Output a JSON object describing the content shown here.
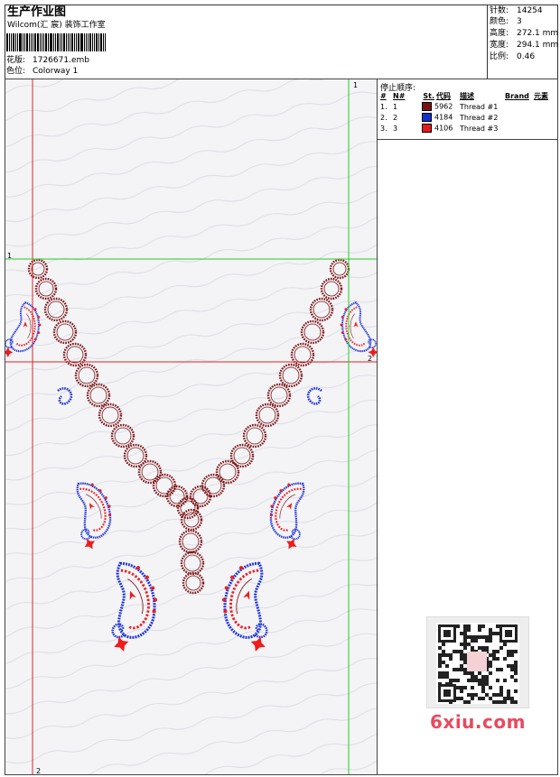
{
  "header": {
    "title": "生产作业图",
    "studio": "Wilcom(汇 宸) 装饰工作室",
    "file_label": "花版:",
    "file_value": "1726671.emb",
    "colorway_label": "色位:",
    "colorway_value": "Colorway 1"
  },
  "specs": {
    "stitches_label": "针数:",
    "stitches_value": "14254",
    "colors_label": "颜色:",
    "colors_value": "3",
    "height_label": "高度:",
    "height_value": "272.1 mm",
    "width_label": "宽度:",
    "width_value": "294.1 mm",
    "scale_label": "比例:",
    "scale_value": "0.46"
  },
  "stop_sequence": {
    "heading": "停止顺序:",
    "columns": [
      "#",
      "N#",
      "St.",
      "代码",
      "描述",
      "Brand",
      "元素"
    ],
    "rows": [
      {
        "num": "1.",
        "n": "1",
        "code": "5962",
        "desc": "Thread #1",
        "color": "#7a1010"
      },
      {
        "num": "2.",
        "n": "2",
        "code": "4184",
        "desc": "Thread #2",
        "color": "#1030d0"
      },
      {
        "num": "3.",
        "n": "3",
        "code": "4106",
        "desc": "Thread #3",
        "color": "#e81818"
      }
    ]
  },
  "guides": {
    "v_top_label": "1",
    "v_bottom_label": "2",
    "h_left_label": "1",
    "h_right_label": "2"
  },
  "colors": {
    "thread1": "#7a1010",
    "thread2": "#1a2fd6",
    "thread3": "#ee1c1c",
    "guide_green": "#22cc22",
    "guide_red": "#e02020"
  },
  "watermark": {
    "text": "6xiu.com"
  },
  "qr_icon": "qr-code-icon"
}
